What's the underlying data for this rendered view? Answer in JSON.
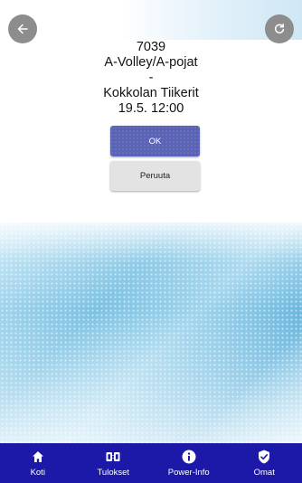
{
  "match": {
    "number": "7039",
    "home_team": "A-Volley/A-pojat",
    "separator": "-",
    "away_team": "Kokkolan Tiikerit",
    "datetime": "19.5. 12:00"
  },
  "dialog": {
    "ok_label": "OK",
    "cancel_label": "Peruuta"
  },
  "nav": {
    "items": [
      {
        "label": "Koti",
        "icon": "home-icon"
      },
      {
        "label": "Tulokset",
        "icon": "scoreboard-icon"
      },
      {
        "label": "Power-Info",
        "icon": "info-icon"
      },
      {
        "label": "Omat",
        "icon": "shield-check-icon"
      }
    ]
  },
  "colors": {
    "nav_bg": "#1d19a8",
    "ok_button": "#5b63b4",
    "cancel_button": "#e3e3e3",
    "round_button": "#8d8d8d"
  }
}
